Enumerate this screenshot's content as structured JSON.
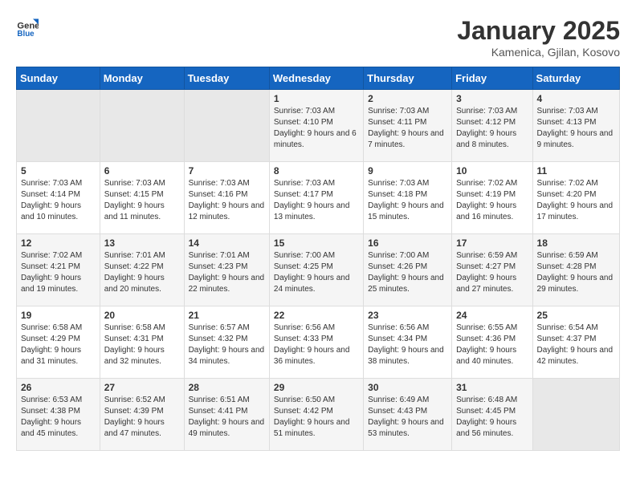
{
  "header": {
    "logo_general": "General",
    "logo_blue": "Blue",
    "month": "January 2025",
    "location": "Kamenica, Gjilan, Kosovo"
  },
  "weekdays": [
    "Sunday",
    "Monday",
    "Tuesday",
    "Wednesday",
    "Thursday",
    "Friday",
    "Saturday"
  ],
  "weeks": [
    [
      {
        "day": "",
        "empty": true
      },
      {
        "day": "",
        "empty": true
      },
      {
        "day": "",
        "empty": true
      },
      {
        "day": "1",
        "sunrise": "7:03 AM",
        "sunset": "4:10 PM",
        "daylight": "9 hours and 6 minutes."
      },
      {
        "day": "2",
        "sunrise": "7:03 AM",
        "sunset": "4:11 PM",
        "daylight": "9 hours and 7 minutes."
      },
      {
        "day": "3",
        "sunrise": "7:03 AM",
        "sunset": "4:12 PM",
        "daylight": "9 hours and 8 minutes."
      },
      {
        "day": "4",
        "sunrise": "7:03 AM",
        "sunset": "4:13 PM",
        "daylight": "9 hours and 9 minutes."
      }
    ],
    [
      {
        "day": "5",
        "sunrise": "7:03 AM",
        "sunset": "4:14 PM",
        "daylight": "9 hours and 10 minutes."
      },
      {
        "day": "6",
        "sunrise": "7:03 AM",
        "sunset": "4:15 PM",
        "daylight": "9 hours and 11 minutes."
      },
      {
        "day": "7",
        "sunrise": "7:03 AM",
        "sunset": "4:16 PM",
        "daylight": "9 hours and 12 minutes."
      },
      {
        "day": "8",
        "sunrise": "7:03 AM",
        "sunset": "4:17 PM",
        "daylight": "9 hours and 13 minutes."
      },
      {
        "day": "9",
        "sunrise": "7:03 AM",
        "sunset": "4:18 PM",
        "daylight": "9 hours and 15 minutes."
      },
      {
        "day": "10",
        "sunrise": "7:02 AM",
        "sunset": "4:19 PM",
        "daylight": "9 hours and 16 minutes."
      },
      {
        "day": "11",
        "sunrise": "7:02 AM",
        "sunset": "4:20 PM",
        "daylight": "9 hours and 17 minutes."
      }
    ],
    [
      {
        "day": "12",
        "sunrise": "7:02 AM",
        "sunset": "4:21 PM",
        "daylight": "9 hours and 19 minutes."
      },
      {
        "day": "13",
        "sunrise": "7:01 AM",
        "sunset": "4:22 PM",
        "daylight": "9 hours and 20 minutes."
      },
      {
        "day": "14",
        "sunrise": "7:01 AM",
        "sunset": "4:23 PM",
        "daylight": "9 hours and 22 minutes."
      },
      {
        "day": "15",
        "sunrise": "7:00 AM",
        "sunset": "4:25 PM",
        "daylight": "9 hours and 24 minutes."
      },
      {
        "day": "16",
        "sunrise": "7:00 AM",
        "sunset": "4:26 PM",
        "daylight": "9 hours and 25 minutes."
      },
      {
        "day": "17",
        "sunrise": "6:59 AM",
        "sunset": "4:27 PM",
        "daylight": "9 hours and 27 minutes."
      },
      {
        "day": "18",
        "sunrise": "6:59 AM",
        "sunset": "4:28 PM",
        "daylight": "9 hours and 29 minutes."
      }
    ],
    [
      {
        "day": "19",
        "sunrise": "6:58 AM",
        "sunset": "4:29 PM",
        "daylight": "9 hours and 31 minutes."
      },
      {
        "day": "20",
        "sunrise": "6:58 AM",
        "sunset": "4:31 PM",
        "daylight": "9 hours and 32 minutes."
      },
      {
        "day": "21",
        "sunrise": "6:57 AM",
        "sunset": "4:32 PM",
        "daylight": "9 hours and 34 minutes."
      },
      {
        "day": "22",
        "sunrise": "6:56 AM",
        "sunset": "4:33 PM",
        "daylight": "9 hours and 36 minutes."
      },
      {
        "day": "23",
        "sunrise": "6:56 AM",
        "sunset": "4:34 PM",
        "daylight": "9 hours and 38 minutes."
      },
      {
        "day": "24",
        "sunrise": "6:55 AM",
        "sunset": "4:36 PM",
        "daylight": "9 hours and 40 minutes."
      },
      {
        "day": "25",
        "sunrise": "6:54 AM",
        "sunset": "4:37 PM",
        "daylight": "9 hours and 42 minutes."
      }
    ],
    [
      {
        "day": "26",
        "sunrise": "6:53 AM",
        "sunset": "4:38 PM",
        "daylight": "9 hours and 45 minutes."
      },
      {
        "day": "27",
        "sunrise": "6:52 AM",
        "sunset": "4:39 PM",
        "daylight": "9 hours and 47 minutes."
      },
      {
        "day": "28",
        "sunrise": "6:51 AM",
        "sunset": "4:41 PM",
        "daylight": "9 hours and 49 minutes."
      },
      {
        "day": "29",
        "sunrise": "6:50 AM",
        "sunset": "4:42 PM",
        "daylight": "9 hours and 51 minutes."
      },
      {
        "day": "30",
        "sunrise": "6:49 AM",
        "sunset": "4:43 PM",
        "daylight": "9 hours and 53 minutes."
      },
      {
        "day": "31",
        "sunrise": "6:48 AM",
        "sunset": "4:45 PM",
        "daylight": "9 hours and 56 minutes."
      },
      {
        "day": "",
        "empty": true
      }
    ]
  ]
}
